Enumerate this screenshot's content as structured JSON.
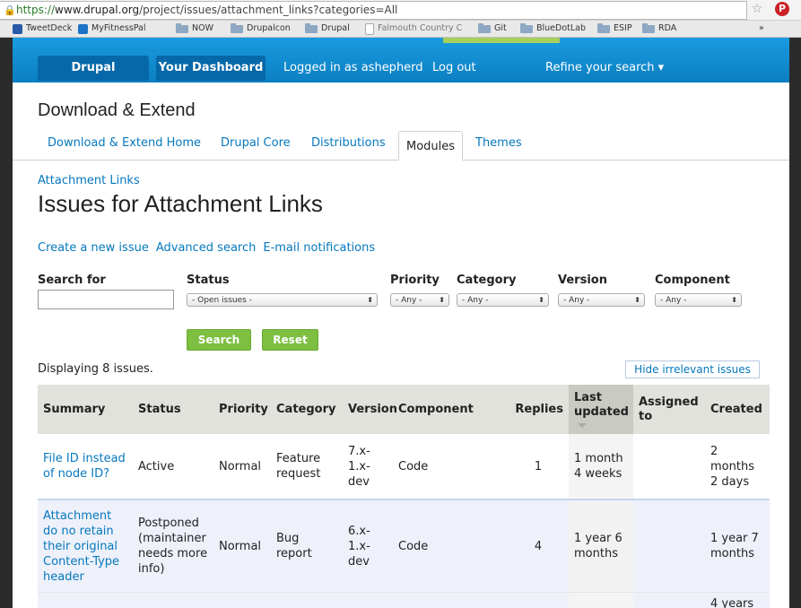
{
  "browser": {
    "url_prefix": "https://",
    "url_host": "www.drupal.org",
    "url_path": "/project/issues/attachment_links?categories=All",
    "bookmarks": [
      "TweetDeck",
      "MyFitnessPal",
      "NOW",
      "Drupalcon",
      "Drupal",
      "Falmouth Country C",
      "Git",
      "BlueDotLab",
      "ESIP",
      "RDA"
    ],
    "more": "»"
  },
  "topnav": {
    "home": "Drupal Homepage",
    "dashboard": "Your Dashboard",
    "logged_in": "Logged in as ashepherd",
    "logout": "Log out",
    "refine": "Refine your search ▾"
  },
  "section_title": "Download & Extend",
  "tabs": [
    "Download & Extend Home",
    "Drupal Core",
    "Distributions",
    "Modules",
    "Themes"
  ],
  "breadcrumb": "Attachment Links",
  "page_title": "Issues for Attachment Links",
  "actions": [
    "Create a new issue",
    "Advanced search",
    "E-mail notifications"
  ],
  "filters": {
    "search_label": "Search for",
    "status_label": "Status",
    "status_value": "- Open issues -",
    "priority_label": "Priority",
    "priority_value": "- Any -",
    "category_label": "Category",
    "category_value": "- Any -",
    "version_label": "Version",
    "version_value": "- Any -",
    "component_label": "Component",
    "component_value": "- Any -",
    "search_button": "Search",
    "reset_button": "Reset"
  },
  "count_text": "Displaying 8 issues.",
  "hide_button": "Hide irrelevant issues",
  "table": {
    "headers": [
      "Summary",
      "Status",
      "Priority",
      "Category",
      "Version",
      "Component",
      "Replies",
      "Last updated",
      "Assigned to",
      "Created"
    ],
    "rows": [
      [
        "File ID instead of node ID?",
        "Active",
        "Normal",
        "Feature request",
        "7.x-1.x-dev",
        "Code",
        "1",
        "1 month 4 weeks",
        "",
        "2 months 2 days"
      ],
      [
        "Attachment do no retain their original Content-Type header",
        "Postponed (maintainer needs more info)",
        "Normal",
        "Bug report",
        "6.x-1.x-dev",
        "Code",
        "4",
        "1 year 6 months",
        "",
        "1 year 7 months"
      ],
      [
        "",
        "",
        "",
        "",
        "",
        "",
        "",
        "",
        "",
        "4 years"
      ]
    ]
  }
}
